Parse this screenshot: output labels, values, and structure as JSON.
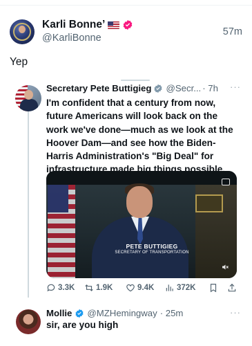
{
  "main_tweet": {
    "display_name": "Karli Bonne’",
    "handle": "@KarliBonne",
    "time": "57m",
    "text": "Yep",
    "flag_icon": "us-flag-emoji",
    "badge_icon": "verified-badge-icon",
    "badge_color": "#f91880"
  },
  "quoted_tweet": {
    "display_name": "Secretary Pete Buttigieg",
    "handle": "@Secr...",
    "time": "· 7h",
    "text": "I'm confident that a century from now, future Americans will look back on the work we've done—much as we look at the Hoover Dam—and see how the Biden-Harris Administration's \"Big Deal\" for infrastructure made big things possible.",
    "badge_color": "#829aab",
    "video": {
      "lower_third_name": "PETE BUTTIGIEG",
      "lower_third_title": "SECRETARY OF TRANSPORTATION"
    },
    "stats": {
      "replies": "3.3K",
      "reposts": "1.9K",
      "likes": "9.4K",
      "views": "372K"
    }
  },
  "reply": {
    "display_name": "Mollie",
    "handle": "@MZHemingway",
    "time": "· 25m",
    "text": "sir, are you high",
    "badge_color": "#1d9bf0"
  },
  "colors": {
    "secondary_text": "#536471",
    "thread_line": "#cfd9de"
  }
}
